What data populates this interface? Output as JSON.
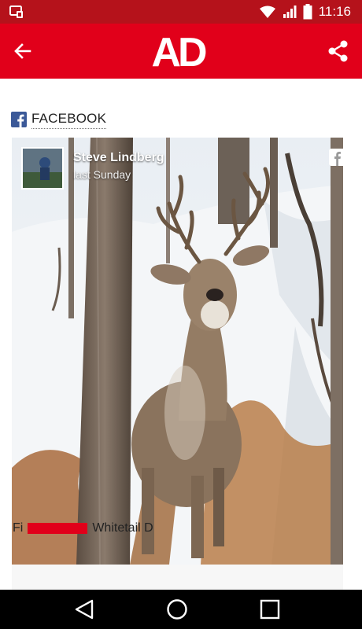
{
  "status_bar": {
    "time": "11:16",
    "left_icon": "screen-share-icon",
    "right_icons": [
      "wifi-icon",
      "signal-icon",
      "battery-icon"
    ]
  },
  "app_bar": {
    "logo_text": "AD",
    "back_icon": "back-arrow-icon",
    "share_icon": "share-icon",
    "color": "#e1001a"
  },
  "section": {
    "icon": "facebook-icon",
    "title": "FACEBOOK"
  },
  "post": {
    "author": "Steve Lindberg",
    "time": "last Sunday",
    "photo": "deer-in-snow-photo",
    "caption_start": "Fi",
    "caption_end": "Whitetail D"
  },
  "nav_bar": {
    "icons": [
      "back-triangle-icon",
      "home-circle-icon",
      "recents-square-icon"
    ]
  }
}
